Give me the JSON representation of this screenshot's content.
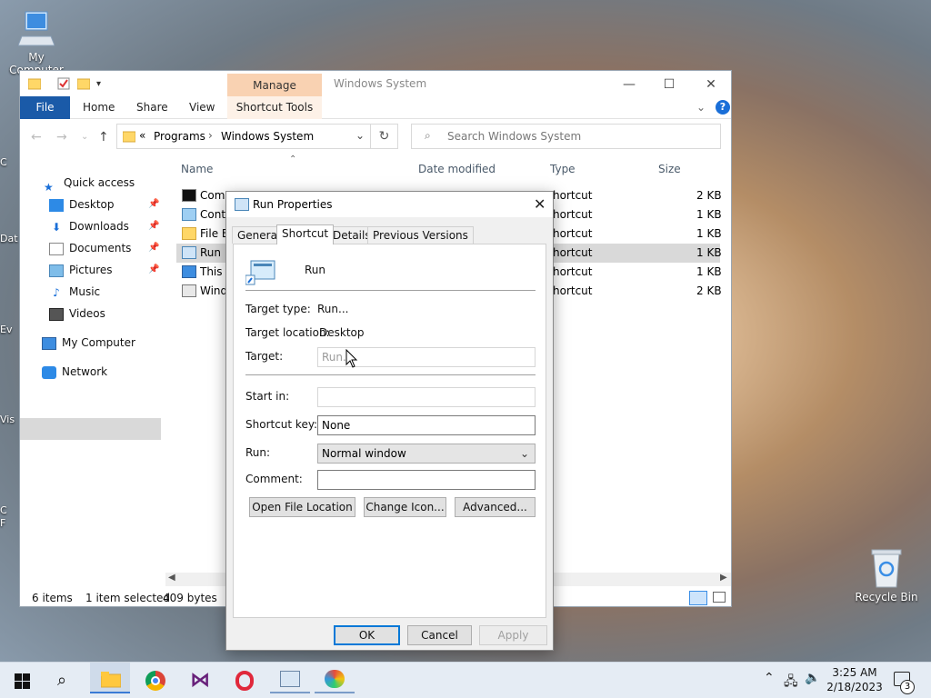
{
  "desktop": {
    "my_computer_label": "My Computer",
    "recycle_bin_label": "Recycle Bin",
    "left_labels": [
      "C",
      "Dat",
      "Ev",
      "Vis",
      "C",
      "F"
    ]
  },
  "explorer": {
    "window_title": "Windows System",
    "manage_label": "Manage",
    "ribbon_tabs": [
      "File",
      "Home",
      "Share",
      "View",
      "Shortcut Tools"
    ],
    "breadcrumb_prefix": "«",
    "breadcrumb": [
      "Programs",
      "Windows System"
    ],
    "search_placeholder": "Search Windows System",
    "nav": {
      "quick_access": "Quick access",
      "desktop": "Desktop",
      "downloads": "Downloads",
      "documents": "Documents",
      "pictures": "Pictures",
      "music": "Music",
      "videos": "Videos",
      "my_computer": "My Computer",
      "network": "Network"
    },
    "columns": {
      "name": "Name",
      "date": "Date modified",
      "type": "Type",
      "size": "Size"
    },
    "files": [
      {
        "name": "Comm",
        "type": "hortcut",
        "size": "2 KB"
      },
      {
        "name": "Contr",
        "type": "hortcut",
        "size": "1 KB"
      },
      {
        "name": "File Ex",
        "type": "hortcut",
        "size": "1 KB"
      },
      {
        "name": "Run",
        "type": "hortcut",
        "size": "1 KB"
      },
      {
        "name": "This P",
        "type": "hortcut",
        "size": "1 KB"
      },
      {
        "name": "Wind",
        "type": "hortcut",
        "size": "2 KB"
      }
    ],
    "status": {
      "items": "6 items",
      "selected": "1 item selected",
      "bytes": "409 bytes"
    }
  },
  "dialog": {
    "title": "Run Properties",
    "tabs": [
      "General",
      "Shortcut",
      "Details",
      "Previous Versions"
    ],
    "name": "Run",
    "target_type_label": "Target type:",
    "target_type_value": "Run...",
    "target_location_label": "Target location:",
    "target_location_value": "Desktop",
    "target_label": "Target:",
    "target_value": "Run...",
    "start_in_label": "Start in:",
    "start_in_value": "",
    "shortcut_key_label": "Shortcut key:",
    "shortcut_key_value": "None",
    "run_label": "Run:",
    "run_value": "Normal window",
    "comment_label": "Comment:",
    "comment_value": "",
    "buttons": {
      "open_file_location": "Open File Location",
      "change_icon": "Change Icon...",
      "advanced": "Advanced...",
      "ok": "OK",
      "cancel": "Cancel",
      "apply": "Apply"
    }
  },
  "taskbar": {
    "time": "3:25 AM",
    "date": "2/18/2023",
    "notification_count": "3"
  },
  "colors": {
    "accent": "#0078d7",
    "file_tab": "#1a5aa8",
    "manage_tab": "#f9d2b2"
  }
}
